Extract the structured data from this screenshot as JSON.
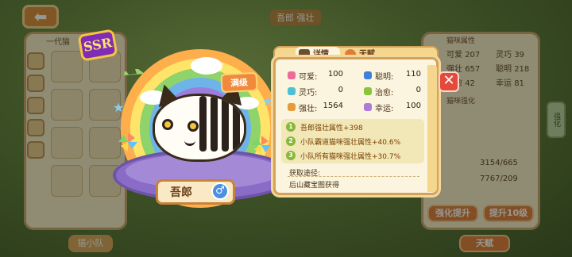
{
  "background": {
    "title": "吾郎",
    "subtitle": "强壮",
    "left_panel_title": "一代猫",
    "right_panel_title": "猫咪属性",
    "right_panel_section": "猫咪强化",
    "right_rows": [
      {
        "label": "可爱",
        "value": "207"
      },
      {
        "label": "灵巧",
        "value": "39"
      },
      {
        "label": "强壮",
        "value": "657"
      },
      {
        "label": "聪明",
        "value": "218"
      },
      {
        "label": "治愈",
        "value": "42"
      },
      {
        "label": "幸运",
        "value": "81"
      }
    ],
    "buttons": {
      "upgrade": "强化提升",
      "upgrade10": "提升10级",
      "talent": "天赋",
      "squad": "猫小队"
    },
    "side_tab": "强化",
    "progress_a": "3154/665",
    "progress_b": "7767/209"
  },
  "cat": {
    "rarity": "SSR",
    "name": "吾郎",
    "gender_symbol": "♂",
    "level_tag": "满级"
  },
  "panel": {
    "tabs": [
      {
        "label": "详情",
        "active": true
      },
      {
        "label": "天赋",
        "active": false
      }
    ],
    "stats": [
      {
        "label": "可爱:",
        "value": "100",
        "icon": "heart-icon",
        "color": "#f06a9a"
      },
      {
        "label": "聪明:",
        "value": "110",
        "icon": "hat-icon",
        "color": "#3f7fd8"
      },
      {
        "label": "灵巧:",
        "value": "0",
        "icon": "ribbon-icon",
        "color": "#4fbfd8"
      },
      {
        "label": "治愈:",
        "value": "0",
        "icon": "clover-icon",
        "color": "#8ac43a"
      },
      {
        "label": "强壮:",
        "value": "1564",
        "icon": "muscle-icon",
        "color": "#e89a3a"
      },
      {
        "label": "幸运:",
        "value": "100",
        "icon": "luck-icon",
        "color": "#b07ad8"
      }
    ],
    "bonuses": [
      {
        "num": "1",
        "text": "吾郎强壮属性+398"
      },
      {
        "num": "2",
        "text": "小队霸道猫咪强壮属性+40.6%"
      },
      {
        "num": "3",
        "text": "小队所有猫咪强壮属性+30.7%"
      }
    ],
    "source_label": "获取途径:",
    "source_text": "后山藏宝图获得",
    "close_label": "✕"
  },
  "colors": {
    "accent": "#f08a3a",
    "panel_bg": "#fbf4de",
    "panel_border": "#d2a25a",
    "bonus_text": "#7a3f00"
  }
}
